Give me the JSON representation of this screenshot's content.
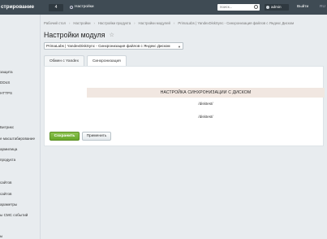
{
  "topbar": {
    "brand": "стрирование",
    "counter": "4",
    "settings_label": "Настройки",
    "search_placeholder": "поиск...",
    "user_name": "admin",
    "logout_label": "Выйти",
    "lang_label": "RU"
  },
  "sidebar": {
    "items": [
      "защита",
      "DDoS",
      "HTTPS",
      "Битрикс",
      "е масштабирование",
      "армилица",
      "продукта",
      "сайтов",
      "сайтов",
      "араметры",
      "ы СМС событий",
      "ы"
    ]
  },
  "breadcrumb": [
    "Рабочий стол",
    "Настройки",
    "Настройки продукта",
    "Настройки модулей",
    "PrimaLabs | YandexDiskSync - Синхронизация файлов с Яндекс Диском"
  ],
  "page": {
    "title": "Настройки модуля"
  },
  "module_select": {
    "value": "PrimaLabs | YandexDiskSync - Синхронизация файлов с Яндекс Диском"
  },
  "tabs": [
    {
      "label": "Обмен с Yandex"
    },
    {
      "label": "Синхронизация"
    }
  ],
  "panel": {
    "section_heading": "НАСТРОЙКА СИНХРОНИЗАЦИИ С ДИСКОМ",
    "value_1": "/disktest/",
    "value_2": "/disktest/",
    "save_label": "Сохранить",
    "apply_label": "Применить"
  },
  "colors": {
    "topbar_bg": "#3f4b54",
    "accent_green": "#6cab2f",
    "section_heading_bg": "#f1e7e1"
  }
}
